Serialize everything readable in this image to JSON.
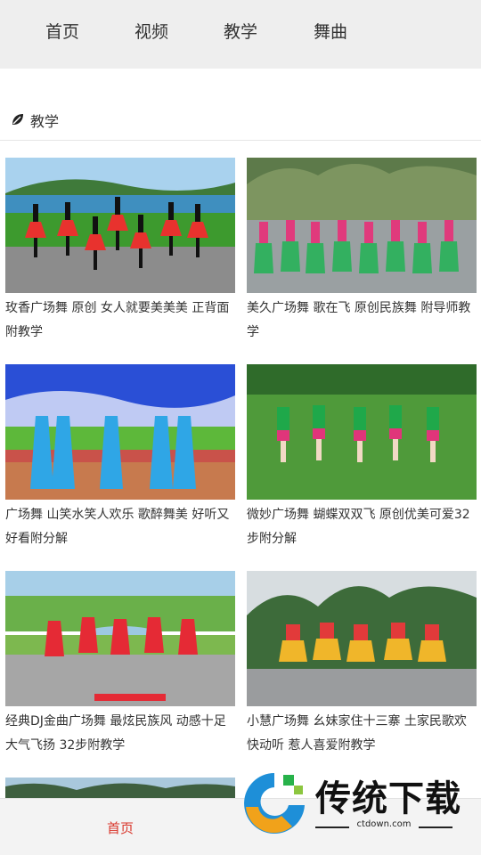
{
  "nav": {
    "tabs": [
      "首页",
      "视频",
      "教学",
      "舞曲"
    ]
  },
  "section": {
    "title": "教学",
    "icon": "leaf-icon"
  },
  "videos": [
    {
      "caption": "玫香广场舞 原创 女人就要美美美 正背面附教学"
    },
    {
      "caption": "美久广场舞 歌在飞 原创民族舞 附导师教学"
    },
    {
      "caption": "广场舞 山笑水笑人欢乐 歌醉舞美 好听又好看附分解"
    },
    {
      "caption": "微妙广场舞 蝴蝶双双飞 原创优美可爱32步附分解"
    },
    {
      "caption": "经典DJ金曲广场舞 最炫民族风 动感十足 大气飞扬 32步附教学"
    },
    {
      "caption": "小慧广场舞 幺妹家住十三寨 土家民歌欢快动听 惹人喜爱附教学"
    }
  ],
  "bottom_bar": {
    "home_label": "首页",
    "active_color": "#d9362b"
  },
  "watermark": {
    "brand": "传统下载",
    "url": "ctdown.com"
  }
}
